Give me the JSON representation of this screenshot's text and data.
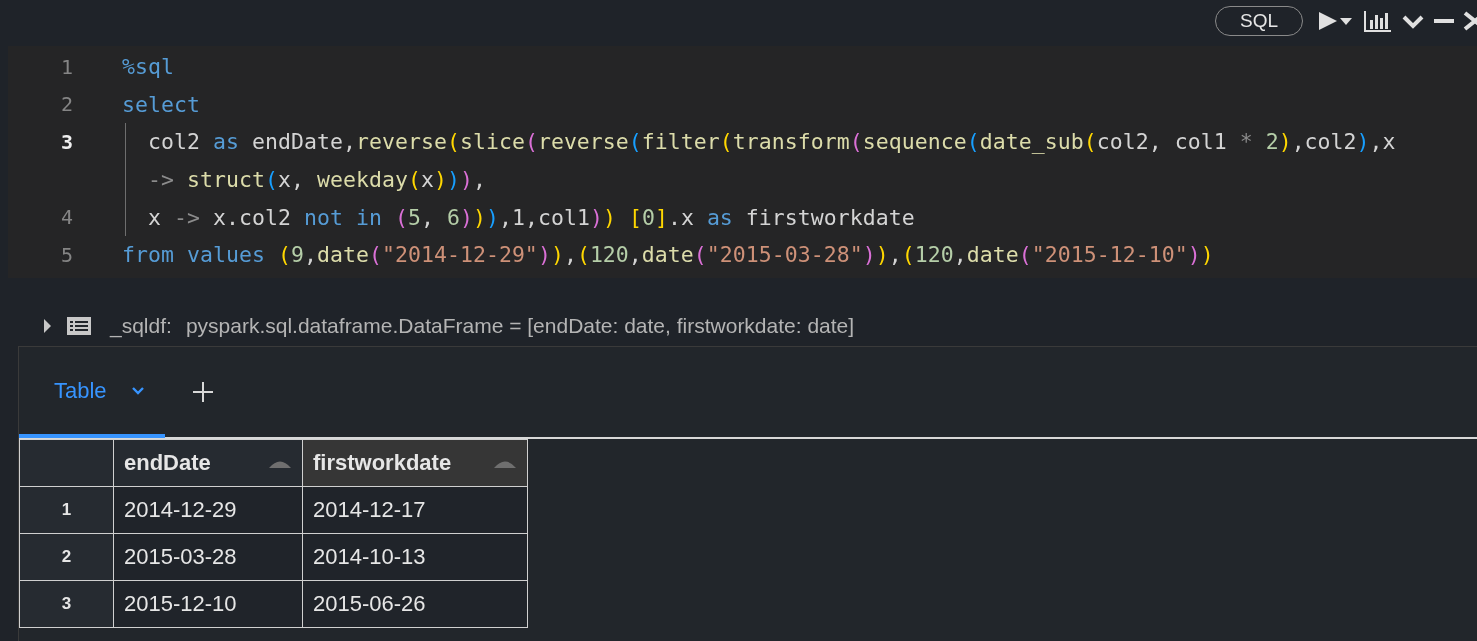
{
  "toolbar": {
    "language": "SQL"
  },
  "code": [
    {
      "number": "1",
      "current": false,
      "indented": false,
      "tokens": [
        {
          "text": "%sql",
          "color": "#569cd6"
        }
      ]
    },
    {
      "number": "2",
      "current": false,
      "indented": false,
      "tokens": [
        {
          "text": "select",
          "color": "#569cd6"
        }
      ]
    },
    {
      "number": "3",
      "current": true,
      "indented": true,
      "tokens": [
        {
          "text": "col2 ",
          "color": "#d4d4d4"
        },
        {
          "text": "as",
          "color": "#569cd6"
        },
        {
          "text": " endDate,",
          "color": "#d4d4d4"
        },
        {
          "text": "reverse",
          "color": "#dcdcaa"
        },
        {
          "text": "(",
          "color": "#ffd700"
        },
        {
          "text": "slice",
          "color": "#dcdcaa"
        },
        {
          "text": "(",
          "color": "#da70d6"
        },
        {
          "text": "reverse",
          "color": "#dcdcaa"
        },
        {
          "text": "(",
          "color": "#179fff"
        },
        {
          "text": "filter",
          "color": "#dcdcaa"
        },
        {
          "text": "(",
          "color": "#ffd700"
        },
        {
          "text": "transform",
          "color": "#dcdcaa"
        },
        {
          "text": "(",
          "color": "#da70d6"
        },
        {
          "text": "sequence",
          "color": "#dcdcaa"
        },
        {
          "text": "(",
          "color": "#179fff"
        },
        {
          "text": "date_sub",
          "color": "#dcdcaa"
        },
        {
          "text": "(",
          "color": "#ffd700"
        },
        {
          "text": "col2, col1 ",
          "color": "#d4d4d4"
        },
        {
          "text": "* ",
          "color": "#8c8c8c"
        },
        {
          "text": "2",
          "color": "#b5cea8"
        },
        {
          "text": ")",
          "color": "#ffd700"
        },
        {
          "text": ",col2",
          "color": "#d4d4d4"
        },
        {
          "text": ")",
          "color": "#179fff"
        },
        {
          "text": ",x",
          "color": "#d4d4d4"
        }
      ]
    },
    {
      "indented": true,
      "tokens": [
        {
          "text": "-> ",
          "color": "#8c8c8c"
        },
        {
          "text": "struct",
          "color": "#dcdcaa"
        },
        {
          "text": "(",
          "color": "#179fff"
        },
        {
          "text": "x, ",
          "color": "#d4d4d4"
        },
        {
          "text": "weekday",
          "color": "#dcdcaa"
        },
        {
          "text": "(",
          "color": "#ffd700"
        },
        {
          "text": "x",
          "color": "#d4d4d4"
        },
        {
          "text": ")",
          "color": "#ffd700"
        },
        {
          "text": ")",
          "color": "#179fff"
        },
        {
          "text": ")",
          "color": "#da70d6"
        },
        {
          "text": ",",
          "color": "#d4d4d4"
        }
      ]
    },
    {
      "number": "4",
      "current": false,
      "indented": true,
      "tokens": [
        {
          "text": "x ",
          "color": "#d4d4d4"
        },
        {
          "text": "->",
          "color": "#8c8c8c"
        },
        {
          "text": " x.col2 ",
          "color": "#d4d4d4"
        },
        {
          "text": "not ",
          "color": "#569cd6"
        },
        {
          "text": "in ",
          "color": "#569cd6"
        },
        {
          "text": "(",
          "color": "#da70d6"
        },
        {
          "text": "5",
          "color": "#b5cea8"
        },
        {
          "text": ", ",
          "color": "#d4d4d4"
        },
        {
          "text": "6",
          "color": "#b5cea8"
        },
        {
          "text": ")",
          "color": "#da70d6"
        },
        {
          "text": ")",
          "color": "#ffd700"
        },
        {
          "text": ")",
          "color": "#179fff"
        },
        {
          "text": ",1,col1",
          "color": "#d4d4d4"
        },
        {
          "text": ")",
          "color": "#da70d6"
        },
        {
          "text": ") ",
          "color": "#ffd700"
        },
        {
          "text": "[",
          "color": "#ffd700"
        },
        {
          "text": "0",
          "color": "#b5cea8"
        },
        {
          "text": "]",
          "color": "#ffd700"
        },
        {
          "text": ".x ",
          "color": "#d4d4d4"
        },
        {
          "text": "as",
          "color": "#569cd6"
        },
        {
          "text": " firstworkdate",
          "color": "#d4d4d4"
        }
      ]
    },
    {
      "number": "5",
      "current": false,
      "indented": false,
      "tokens": [
        {
          "text": "from ",
          "color": "#569cd6"
        },
        {
          "text": "values ",
          "color": "#569cd6"
        },
        {
          "text": "(",
          "color": "#ffd700"
        },
        {
          "text": "9",
          "color": "#b5cea8"
        },
        {
          "text": ",",
          "color": "#d4d4d4"
        },
        {
          "text": "date",
          "color": "#dcdcaa"
        },
        {
          "text": "(",
          "color": "#da70d6"
        },
        {
          "text": "\"2014-12-29\"",
          "color": "#ce9178"
        },
        {
          "text": ")",
          "color": "#da70d6"
        },
        {
          "text": ")",
          "color": "#ffd700"
        },
        {
          "text": ",",
          "color": "#d4d4d4"
        },
        {
          "text": "(",
          "color": "#ffd700"
        },
        {
          "text": "120",
          "color": "#b5cea8"
        },
        {
          "text": ",",
          "color": "#d4d4d4"
        },
        {
          "text": "date",
          "color": "#dcdcaa"
        },
        {
          "text": "(",
          "color": "#da70d6"
        },
        {
          "text": "\"2015-03-28\"",
          "color": "#ce9178"
        },
        {
          "text": ")",
          "color": "#da70d6"
        },
        {
          "text": ")",
          "color": "#ffd700"
        },
        {
          "text": ",",
          "color": "#d4d4d4"
        },
        {
          "text": "(",
          "color": "#ffd700"
        },
        {
          "text": "120",
          "color": "#b5cea8"
        },
        {
          "text": ",",
          "color": "#d4d4d4"
        },
        {
          "text": "date",
          "color": "#dcdcaa"
        },
        {
          "text": "(",
          "color": "#da70d6"
        },
        {
          "text": "\"2015-12-10\"",
          "color": "#ce9178"
        },
        {
          "text": ")",
          "color": "#da70d6"
        },
        {
          "text": ")",
          "color": "#ffd700"
        }
      ]
    }
  ],
  "output": {
    "expanded": false,
    "name": "_sqldf:",
    "schema": "pyspark.sql.dataframe.DataFrame = [endDate: date, firstworkdate: date]"
  },
  "tabs": [
    {
      "label": "Table",
      "selected": true
    }
  ],
  "table": {
    "columns": [
      {
        "label": "endDate",
        "hovered": false
      },
      {
        "label": "firstworkdate",
        "hovered": true
      }
    ],
    "rows": [
      {
        "index": "1",
        "cells": [
          "2014-12-29",
          "2014-12-17"
        ]
      },
      {
        "index": "2",
        "cells": [
          "2015-03-28",
          "2014-10-13"
        ]
      },
      {
        "index": "3",
        "cells": [
          "2015-12-10",
          "2015-06-26"
        ]
      }
    ]
  }
}
